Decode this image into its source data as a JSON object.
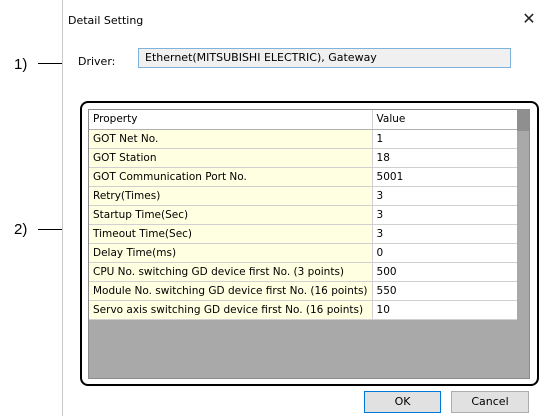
{
  "annotations": {
    "one": "1)",
    "two": "2)"
  },
  "dialog": {
    "title": "Detail Setting",
    "close_glyph": "✕"
  },
  "driver": {
    "label": "Driver:",
    "value": "Ethernet(MITSUBISHI ELECTRIC), Gateway"
  },
  "grid": {
    "headers": {
      "property": "Property",
      "value": "Value"
    },
    "rows": [
      {
        "property": "GOT Net No.",
        "value": "1"
      },
      {
        "property": "GOT Station",
        "value": "18"
      },
      {
        "property": "GOT Communication Port No.",
        "value": "5001"
      },
      {
        "property": "Retry(Times)",
        "value": "3"
      },
      {
        "property": "Startup Time(Sec)",
        "value": "3"
      },
      {
        "property": "Timeout Time(Sec)",
        "value": "3"
      },
      {
        "property": "Delay Time(ms)",
        "value": "0"
      },
      {
        "property": "CPU No. switching GD device first No. (3 points)",
        "value": "500"
      },
      {
        "property": "Module No. switching GD device first No. (16 points)",
        "value": "550"
      },
      {
        "property": "Servo axis switching GD device first No. (16 points)",
        "value": "10"
      }
    ]
  },
  "buttons": {
    "ok": "OK",
    "cancel": "Cancel"
  },
  "colors": {
    "property_bg": "#ffffe1",
    "grid_bg": "#a9a9a9",
    "accent": "#0078d7"
  }
}
